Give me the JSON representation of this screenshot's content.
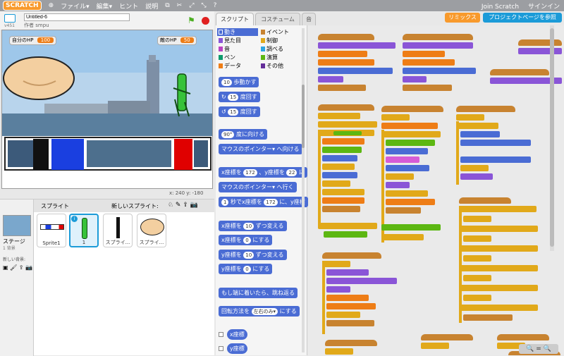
{
  "topbar": {
    "logo": "SCRATCH",
    "menus": [
      "ファイル▾",
      "編集▾",
      "ヒント",
      "説明"
    ],
    "join": "Join Scratch",
    "signin": "サインイン"
  },
  "project": {
    "version": "v451",
    "title": "Untitled-6",
    "author": "作者 smpu"
  },
  "stage": {
    "my_hp_label": "自分のHP",
    "my_hp_value": "100",
    "enemy_hp_label": "敵のHP",
    "enemy_hp_value": "50",
    "coords": "x: 240   y: -180"
  },
  "sprites": {
    "header": "スプライト",
    "new_sprite": "新しいスプライト:",
    "stage_label": "ステージ",
    "stage_sub": "1 背景",
    "new_backdrop": "新しい背景:",
    "items": [
      "Sprite1",
      "1",
      "スプライ...",
      "スプライ..."
    ],
    "selected_badge": "i"
  },
  "tabs": [
    "スクリプト",
    "コスチューム",
    "音"
  ],
  "buttons": {
    "remix": "リミックス",
    "project_page": "プロジェクトページを参照"
  },
  "categories": [
    {
      "label": "動き",
      "color": "#4a6cd4"
    },
    {
      "label": "イベント",
      "color": "#c88330"
    },
    {
      "label": "見た目",
      "color": "#8a55d7"
    },
    {
      "label": "制御",
      "color": "#e1a91a"
    },
    {
      "label": "音",
      "color": "#bb42c3"
    },
    {
      "label": "調べる",
      "color": "#2ca5e2"
    },
    {
      "label": "ペン",
      "color": "#0e9a6c"
    },
    {
      "label": "演算",
      "color": "#5cb712"
    },
    {
      "label": "データ",
      "color": "#ee7d16"
    },
    {
      "label": "その他",
      "color": "#632d99"
    }
  ],
  "palette_blocks": {
    "b1": "歩動かす",
    "b1v": "10",
    "b2": "度回す",
    "b2v": "15",
    "b3": "度回す",
    "b3v": "15",
    "b4": "度に向ける",
    "b4v": "90°",
    "b5": "マウスのポインター▾ へ向ける",
    "b6a": "x座標を",
    "b6v1": "172",
    "b6b": "、y座標を",
    "b6v2": "22",
    "b6c": "に",
    "b7": "マウスのポインター▾ へ行く",
    "b8a": "秒でx座標を",
    "b8v1": "1",
    "b8v2": "172",
    "b8b": "に、y座標",
    "b9": "x座標を",
    "b9v": "10",
    "b9b": "ずつ変える",
    "b10": "x座標を",
    "b10v": "0",
    "b10b": "にする",
    "b11": "y座標を",
    "b11v": "10",
    "b11b": "ずつ変える",
    "b12": "y座標を",
    "b12v": "0",
    "b12b": "にする",
    "b13": "もし端に着いたら、跳ね返る",
    "b14a": "回転方法を",
    "b14v": "左右のみ▾",
    "b14b": "にする",
    "c1": "x座標",
    "c2": "y座標"
  },
  "zoom": "🔍 = 🔍"
}
